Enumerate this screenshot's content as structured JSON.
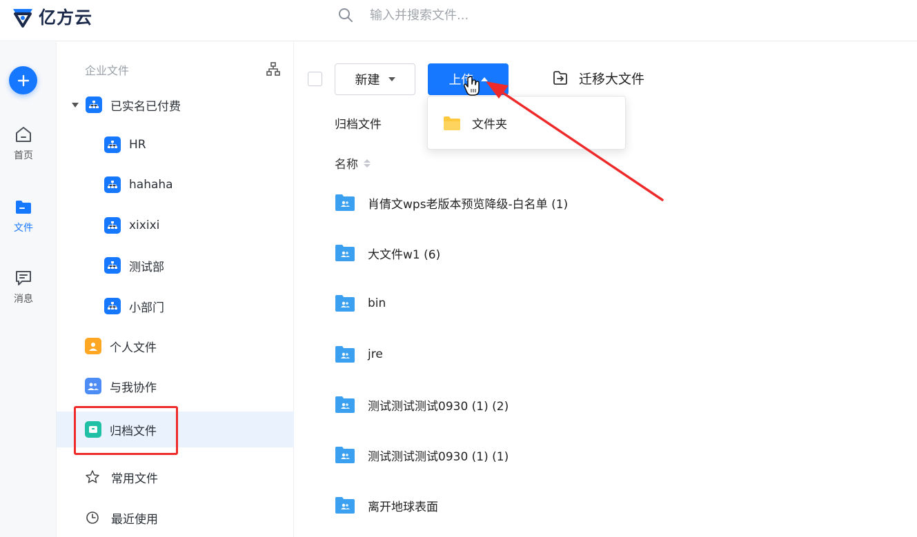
{
  "brand": {
    "name": "亿方云",
    "color": "#1677ff"
  },
  "search": {
    "placeholder": "输入并搜索文件..."
  },
  "rail": {
    "add_icon": "plus-icon",
    "items": [
      {
        "label": "首页",
        "icon": "home-icon"
      },
      {
        "label": "文件",
        "icon": "folder-icon",
        "active": true
      },
      {
        "label": "消息",
        "icon": "message-icon"
      }
    ]
  },
  "tree": {
    "header": "企业文件",
    "root": {
      "label": "已实名已付费",
      "expanded": true
    },
    "departments": [
      "HR",
      "hahaha",
      "xixixi",
      "测试部",
      "小部门"
    ],
    "personal": "个人文件",
    "shared": "与我协作",
    "archive": "归档文件",
    "favorites": "常用文件",
    "recent": "最近使用"
  },
  "toolbar": {
    "new_label": "新建",
    "upload_label": "上传",
    "migrate_label": "迁移大文件"
  },
  "upload_menu": {
    "items": [
      "文件夹"
    ]
  },
  "breadcrumb": "归档文件",
  "table": {
    "name_header": "名称",
    "rows": [
      "肖倩文wps老版本预览降级-白名单 (1)",
      "大文件w1 (6)",
      "bin",
      "jre",
      "测试测试测试0930 (1) (2)",
      "测试测试测试0930 (1) (1)",
      "离开地球表面"
    ]
  },
  "colors": {
    "primary": "#1677ff",
    "annotation_red": "#ee2a2a",
    "folder_yellow": "#ffc83d",
    "shared_folder_blue": "#3aa0ef"
  }
}
